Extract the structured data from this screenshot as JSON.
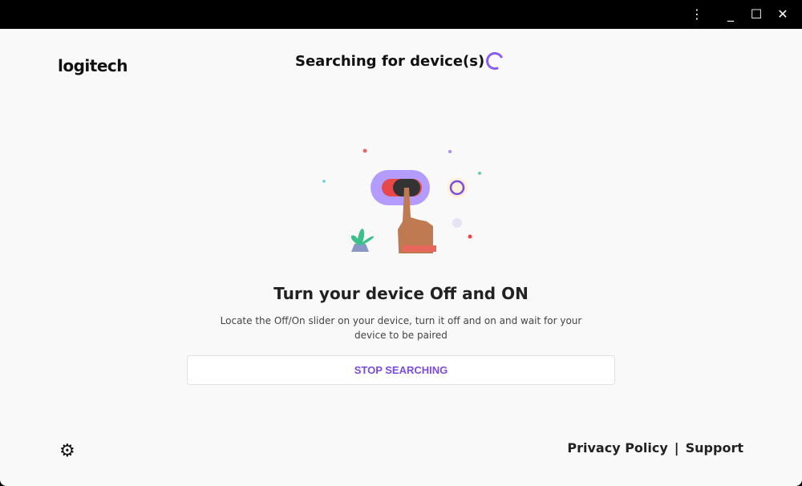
{
  "window": {
    "menu_icon": "more-vert-icon",
    "minimize_icon": "minimize-icon",
    "maximize_icon": "maximize-icon",
    "close_icon": "close-icon"
  },
  "header": {
    "logo": "logitech",
    "title": "Searching for device(s)"
  },
  "main": {
    "heading": "Turn your device Off and ON",
    "description": "Locate the Off/On slider on your device, turn it off and on and wait for your device to be paired",
    "stop_button": "STOP SEARCHING"
  },
  "footer": {
    "privacy": "Privacy Policy",
    "separator": "|",
    "support": "Support",
    "settings_icon": "gear-icon"
  },
  "colors": {
    "accent": "#7c4ddb",
    "background": "#f9f9f9"
  }
}
